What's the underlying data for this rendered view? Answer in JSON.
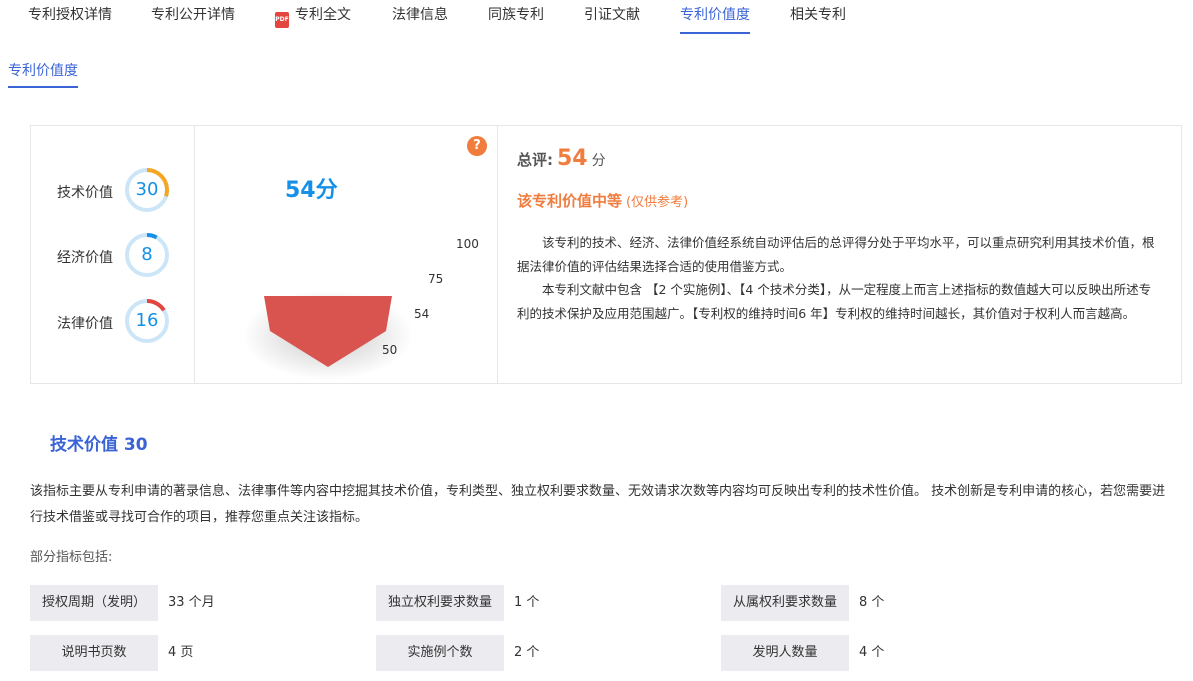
{
  "nav": {
    "tabs": [
      {
        "label": "专利授权详情"
      },
      {
        "label": "专利公开详情"
      },
      {
        "label": "专利全文",
        "icon": "pdf-icon"
      },
      {
        "label": "法律信息"
      },
      {
        "label": "同族专利"
      },
      {
        "label": "引证文献"
      },
      {
        "label": "专利价值度",
        "active": true
      },
      {
        "label": "相关专利"
      }
    ],
    "pdf_icon_text": "PDF"
  },
  "sub_tab": {
    "label": "专利价值度"
  },
  "metrics": [
    {
      "label": "技术价值",
      "value": "30",
      "percent": 30,
      "color": "#f5a623"
    },
    {
      "label": "经济价值",
      "value": "8",
      "percent": 8,
      "color": "#1590e8"
    },
    {
      "label": "法律价值",
      "value": "16",
      "percent": 16,
      "color": "#e2463f"
    }
  ],
  "score": {
    "big": "54分",
    "help": "?",
    "funnel_levels": [
      "100",
      "75",
      "54",
      "50"
    ],
    "funnel_color": "#d9534f"
  },
  "summary": {
    "label": "总评:",
    "score": "54",
    "unit": "分",
    "level": "该专利价值中等",
    "note": "(仅供参考)",
    "p1": "该专利的技术、经济、法律价值经系统自动评估后的总评得分处于平均水平，可以重点研究利用其技术价值，根据法律价值的评估结果选择合适的使用借鉴方式。",
    "p2": "本专利文献中包含 【2 个实施例】、【4 个技术分类】，从一定程度上而言上述指标的数值越大可以反映出所述专利的技术保护及应用范围越广。【专利权的维持时间6 年】专利权的维持时间越长，其价值对于权利人而言越高。"
  },
  "section": {
    "title": "技术价值 30",
    "desc": "该指标主要从专利申请的著录信息、法律事件等内容中挖掘其技术价值，专利类型、独立权利要求数量、无效请求次数等内容均可反映出专利的技术性价值。 技术创新是专利申请的核心，若您需要进行技术借鉴或寻找可合作的项目，推荐您重点关注该指标。",
    "sub_label": "部分指标包括:",
    "indicators": [
      {
        "key": "授权周期（发明）",
        "value": "33 个月"
      },
      {
        "key": "独立权利要求数量",
        "value": "1 个"
      },
      {
        "key": "从属权利要求数量",
        "value": "8 个"
      },
      {
        "key": "说明书页数",
        "value": "4 页"
      },
      {
        "key": "实施例个数",
        "value": "2 个"
      },
      {
        "key": "发明人数量",
        "value": "4 个"
      }
    ]
  }
}
